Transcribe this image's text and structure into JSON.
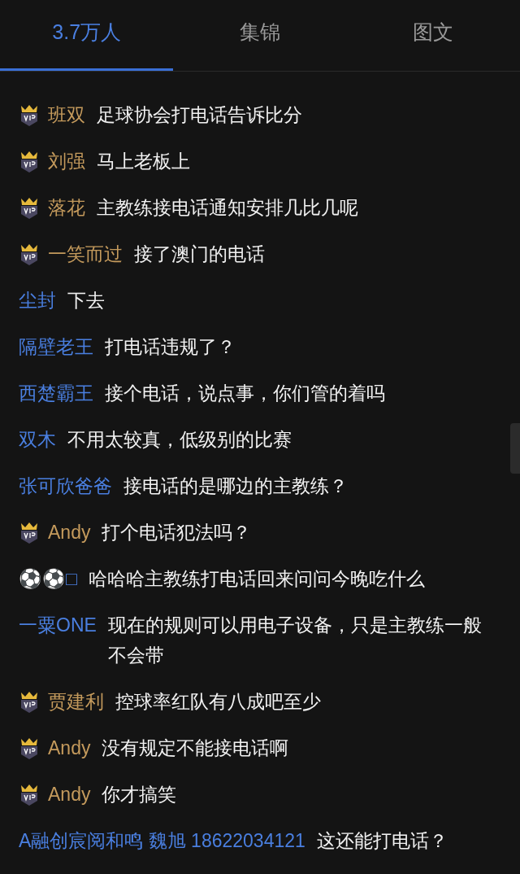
{
  "tabs": [
    {
      "label": "3.7万人",
      "selected": true
    },
    {
      "label": "集锦",
      "selected": false
    },
    {
      "label": "图文",
      "selected": false
    }
  ],
  "messages": [
    {
      "vip": true,
      "user": "班双",
      "text": "足球协会打电话告诉比分"
    },
    {
      "vip": true,
      "user": "刘强",
      "text": "马上老板上"
    },
    {
      "vip": true,
      "user": "落花",
      "text": "主教练接电话通知安排几比几呢"
    },
    {
      "vip": true,
      "user": "一笑而过",
      "text": "接了澳门的电话"
    },
    {
      "vip": false,
      "user": "尘封",
      "text": "下去"
    },
    {
      "vip": false,
      "user": "隔壁老王",
      "text": "打电话违规了？"
    },
    {
      "vip": false,
      "user": "西楚霸王",
      "text": "接个电话，说点事，你们管的着吗"
    },
    {
      "vip": false,
      "user": "双木",
      "text": "不用太较真，低级别的比赛"
    },
    {
      "vip": false,
      "user": "张可欣爸爸",
      "text": "接电话的是哪边的主教练？"
    },
    {
      "vip": true,
      "user": "Andy",
      "text": "打个电话犯法吗？"
    },
    {
      "vip": false,
      "user": "⚽⚽□",
      "text": "哈哈哈主教练打电话回来问问今晚吃什么"
    },
    {
      "vip": false,
      "user": "一粟ONE",
      "text": "现在的规则可以用电子设备，只是主教练一般不会带"
    },
    {
      "vip": true,
      "user": "贾建利",
      "text": "控球率红队有八成吧至少"
    },
    {
      "vip": true,
      "user": "Andy",
      "text": "没有规定不能接电话啊"
    },
    {
      "vip": true,
      "user": "Andy",
      "text": "你才搞笑"
    },
    {
      "vip": false,
      "user": "A融创宸阅和鸣 魏旭 18622034121",
      "text": "这还能打电话？"
    }
  ]
}
